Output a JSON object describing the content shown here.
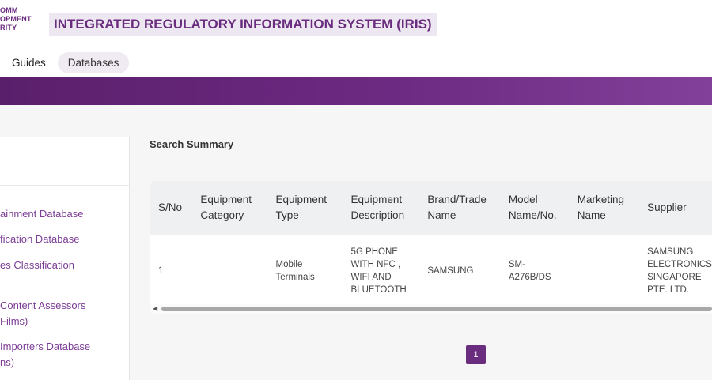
{
  "header": {
    "logo_lines": [
      "OMM",
      "OPMENT",
      "RITY"
    ],
    "system_title": "INTEGRATED REGULATORY INFORMATION SYSTEM (IRIS)"
  },
  "nav": {
    "items": [
      {
        "label": "Guides",
        "active": false
      },
      {
        "label": "Databases",
        "active": true
      }
    ]
  },
  "colors": {
    "brand_purple": "#6a2c7e",
    "banner_start": "#5a1f6b",
    "banner_end": "#83409a"
  },
  "sidebar": {
    "links": [
      {
        "lines": [
          "ainment Database"
        ]
      },
      {
        "lines": [
          "fication Database"
        ]
      },
      {
        "lines": [
          "es Classification"
        ]
      },
      {
        "lines": [
          "Content Assessors",
          "Films)"
        ]
      },
      {
        "lines": [
          "Importers Database",
          "ns)"
        ]
      }
    ]
  },
  "main": {
    "summary_title": "Search Summary",
    "table": {
      "headers": [
        [
          "S/No"
        ],
        [
          "Equipment",
          "Category"
        ],
        [
          "Equipment",
          "Type"
        ],
        [
          "Equipment",
          "Description"
        ],
        [
          "Brand/Trade",
          "Name"
        ],
        [
          "Model",
          "Name/No."
        ],
        [
          "Marketing",
          "Name"
        ],
        [
          "Supplier"
        ]
      ],
      "rows": [
        [
          [
            "1"
          ],
          [
            ""
          ],
          [
            "Mobile",
            "Terminals"
          ],
          [
            "5G PHONE",
            "WITH NFC ,",
            "WIFI AND",
            "BLUETOOTH"
          ],
          [
            "SAMSUNG"
          ],
          [
            "SM-",
            "A276B/DS"
          ],
          [
            ""
          ],
          [
            "SAMSUNG",
            "ELECTRONICS",
            "SINGAPORE",
            "PTE. LTD."
          ]
        ]
      ]
    },
    "pagination": {
      "current_page": "1"
    }
  }
}
